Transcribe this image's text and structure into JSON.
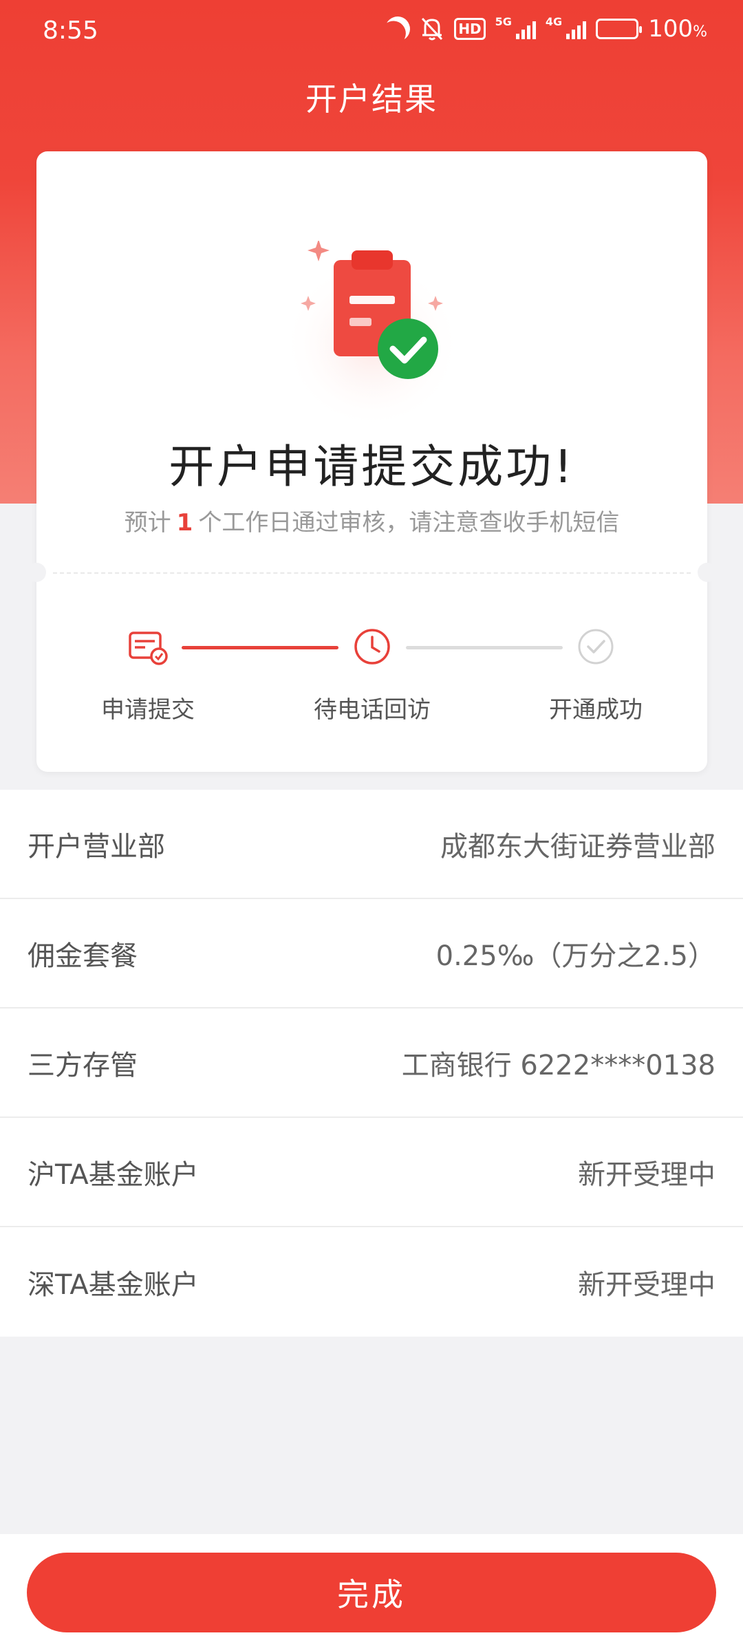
{
  "status_bar": {
    "time": "8:55",
    "hd_label": "HD",
    "net_5g": "5G",
    "net_4g": "4G",
    "battery_percent": "100",
    "battery_unit": "%",
    "battery_level": 1.0
  },
  "header": {
    "title": "开户结果"
  },
  "result": {
    "title": "开户申请提交成功!",
    "subtitle_prefix": "预计",
    "subtitle_days": "1",
    "subtitle_suffix": "个工作日通过审核，请注意查收手机短信"
  },
  "steps": [
    {
      "label": "申请提交",
      "state": "done"
    },
    {
      "label": "待电话回访",
      "state": "current"
    },
    {
      "label": "开通成功",
      "state": "pending"
    }
  ],
  "info": {
    "rows": [
      {
        "label": "开户营业部",
        "value": "成都东大街证券营业部"
      },
      {
        "label": "佣金套餐",
        "value": "0.25‰（万分之2.5）"
      },
      {
        "label": "三方存管",
        "value": "工商银行 6222****0138"
      },
      {
        "label": "沪TA基金账户",
        "value": "新开受理中"
      },
      {
        "label": "深TA基金账户",
        "value": "新开受理中"
      }
    ]
  },
  "footer": {
    "done_label": "完成"
  },
  "colors": {
    "accent": "#ef3f34",
    "success": "#22a845",
    "pending": "#d6d6d6"
  }
}
